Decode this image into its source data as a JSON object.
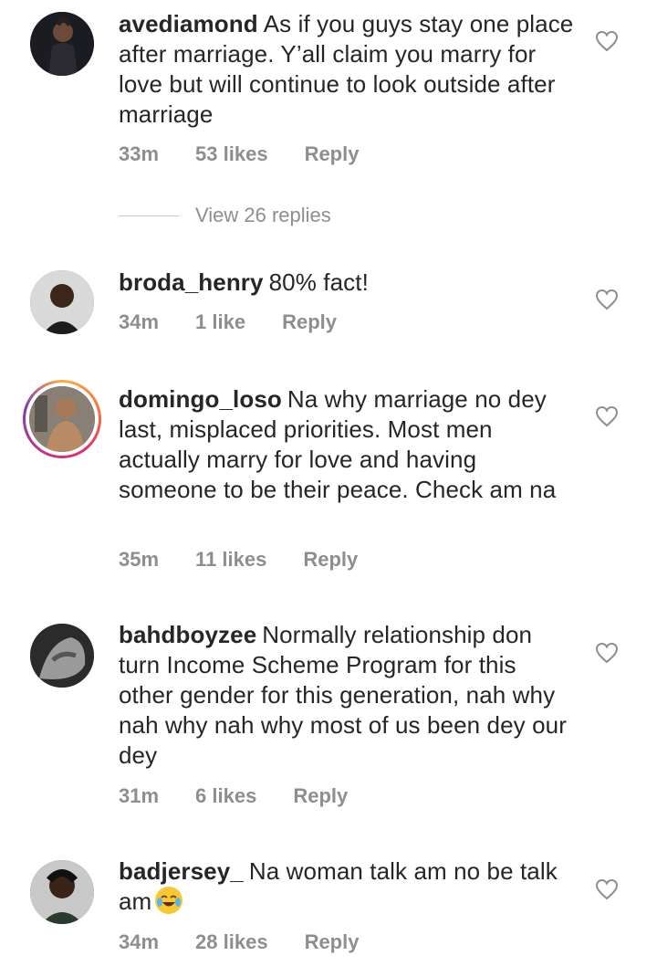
{
  "comments": [
    {
      "username": "avediamond",
      "text": "As if you guys stay one place after marriage. Y’all claim you marry for love but will continue to look outside after marriage",
      "time": "33m",
      "likes": "53 likes",
      "reply": "Reply"
    },
    {
      "username": "broda_henry",
      "text": "80% fact!",
      "time": "34m",
      "likes": "1 like",
      "reply": "Reply"
    },
    {
      "username": "domingo_loso",
      "text": "Na why marriage no dey last, misplaced priorities. Most men actually marry for love and having someone to be their peace. Check  am na",
      "time": "35m",
      "likes": "11 likes",
      "reply": "Reply"
    },
    {
      "username": "bahdboyzee",
      "text": "Normally relationship don turn Income Scheme Program for this other gender for this generation, nah why nah why nah why most of us been dey our dey",
      "time": "31m",
      "likes": "6 likes",
      "reply": "Reply"
    },
    {
      "username": "badjersey_",
      "text": "Na woman talk am no be talk am",
      "time": "34m",
      "likes": "28 likes",
      "reply": "Reply"
    }
  ],
  "view_replies": "View 26 replies",
  "icons": {
    "like": "heart-outline-icon",
    "emoji": "face-with-tears-of-joy"
  },
  "colors": {
    "text": "#262626",
    "meta": "#8e8e8e",
    "story_ring": [
      "#fcaf45",
      "#e1306c",
      "#833ab4"
    ]
  }
}
